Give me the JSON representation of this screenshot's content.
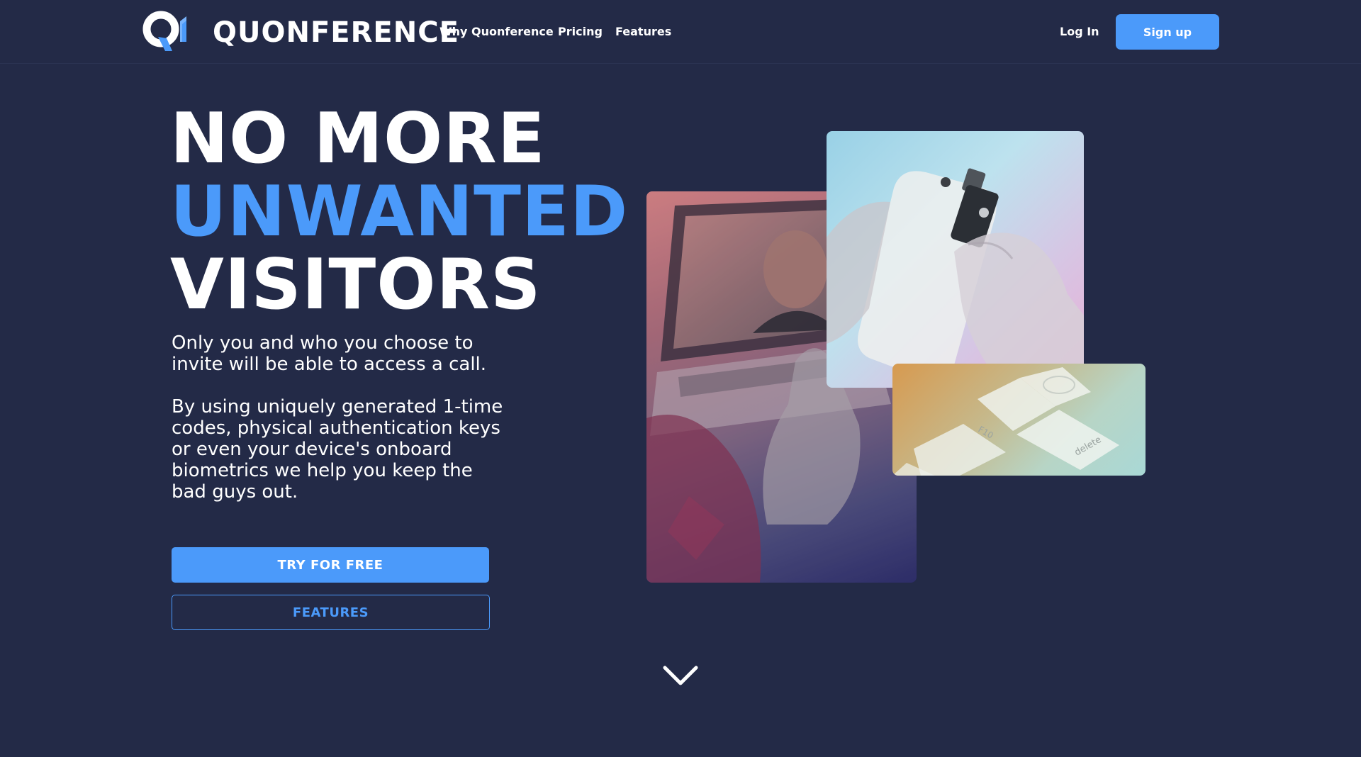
{
  "header": {
    "brand": "QUONFERENCE",
    "nav": {
      "why": "Why Quonference",
      "pricing": "Pricing",
      "features": "Features"
    },
    "login_label": "Log In",
    "signup_label": "Sign up"
  },
  "hero": {
    "headline_line1": "NO MORE",
    "headline_line2": "UNWANTED",
    "headline_line3": "VISITORS",
    "lead1": "Only you and who you choose to invite will be able to access a call.",
    "lead2": "By using uniquely generated 1-time codes, physical authentication keys or even your device's onboard biometrics we help you keep the bad guys out.",
    "cta_primary": "TRY FOR FREE",
    "cta_secondary": "FEATURES"
  },
  "images": {
    "laptop_photo": "video-call-laptop-photo",
    "security_key_photo": "phone-security-key-photo",
    "keyboard_photo": "keyboard-keys-photo",
    "keyboard_key_labels": [
      "F10",
      "delete"
    ]
  },
  "icons": {
    "logo": "quonference-logo-icon",
    "scroll": "chevron-down-icon"
  },
  "colors": {
    "background": "#232a47",
    "accent": "#4b9afa",
    "text": "#ffffff"
  }
}
